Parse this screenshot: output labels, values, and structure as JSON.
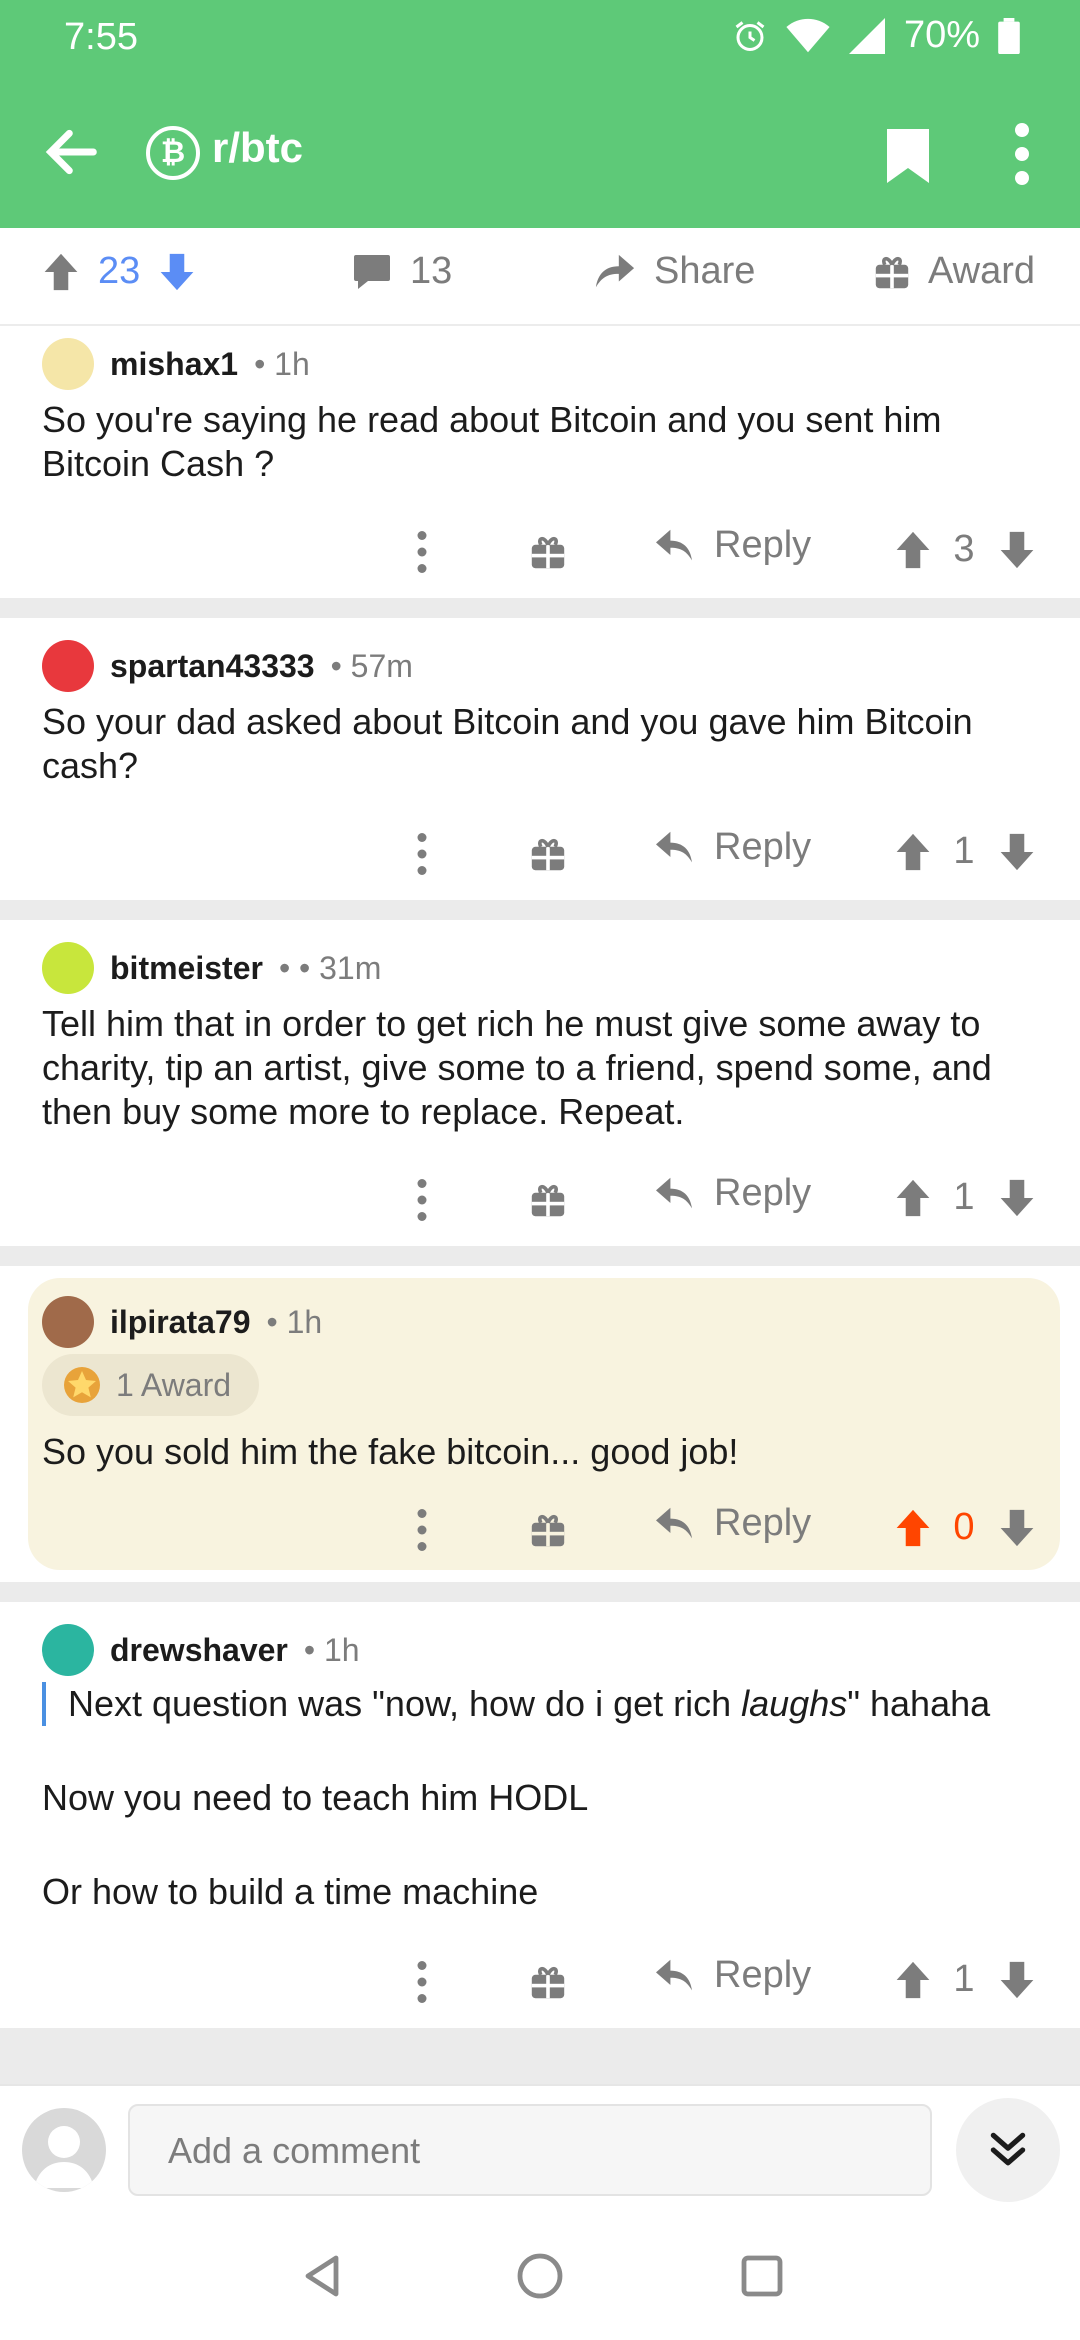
{
  "status_bar": {
    "time": "7:55",
    "battery": "70%"
  },
  "app_bar": {
    "subreddit_icon": "bitcoin-icon",
    "subreddit": "r/btc"
  },
  "post_actions": {
    "score": "23",
    "comments": "13",
    "share_label": "Share",
    "award_label": "Award"
  },
  "comments": [
    {
      "author": "mishax1",
      "meta": "• 1h",
      "body": "So you're saying he read about Bitcoin and you sent him Bitcoin Cash ?",
      "score": "3",
      "reply_label": "Reply",
      "avatar_color": "#f5e6a8"
    },
    {
      "author": "spartan43333",
      "meta": "• 57m",
      "body": "So your dad asked about Bitcoin and you gave him Bitcoin cash?",
      "score": "1",
      "reply_label": "Reply",
      "avatar_color": "#e8383d"
    },
    {
      "author": "bitmeister",
      "meta": "•  • 31m",
      "body": "Tell him that in order to get rich he must give some away to charity, tip an artist, give some to a friend, spend some, and then buy some more to replace. Repeat.",
      "score": "1",
      "reply_label": "Reply",
      "avatar_color": "#c8e63c"
    },
    {
      "author": "ilpirata79",
      "meta": "• 1h",
      "award": "1 Award",
      "body": "So you sold him the fake bitcoin... good job!",
      "score": "0",
      "reply_label": "Reply",
      "avatar_color": "#a06a4a",
      "score_color": "#ff4500"
    },
    {
      "author": "drewshaver",
      "meta": "• 1h",
      "quote_pre": "Next question was \"now, how do i get rich ",
      "quote_em": "laughs",
      "quote_post": "\" hahaha",
      "line2": "Now you need to teach him HODL",
      "line3": "Or how to build a time machine",
      "score": "1",
      "reply_label": "Reply",
      "avatar_color": "#2bb5a0"
    }
  ],
  "composer": {
    "placeholder": "Add a comment"
  },
  "colors": {
    "brand_green": "#5ec978",
    "upvote_orange": "#ff4500",
    "vote_blue": "#5b8df5"
  }
}
